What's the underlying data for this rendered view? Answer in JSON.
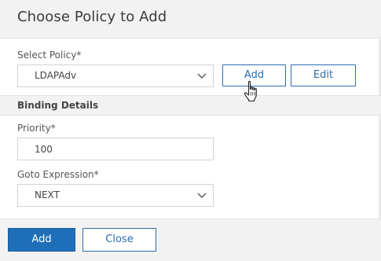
{
  "dialog": {
    "title": "Choose Policy to Add"
  },
  "select_policy": {
    "label": "Select Policy*",
    "value": "LDAPAdv",
    "add_label": "Add",
    "edit_label": "Edit"
  },
  "binding_details": {
    "title": "Binding Details",
    "priority_label": "Priority*",
    "priority_value": "100",
    "goto_label": "Goto Expression*",
    "goto_value": "NEXT"
  },
  "footer": {
    "add_label": "Add",
    "close_label": "Close"
  },
  "colors": {
    "accent": "#1f6fb8",
    "header_bg": "#f2f2f2",
    "border": "#cfd3d7"
  },
  "icons": {
    "dropdown": "chevron-down-icon",
    "cursor": "hand-pointer-icon"
  }
}
